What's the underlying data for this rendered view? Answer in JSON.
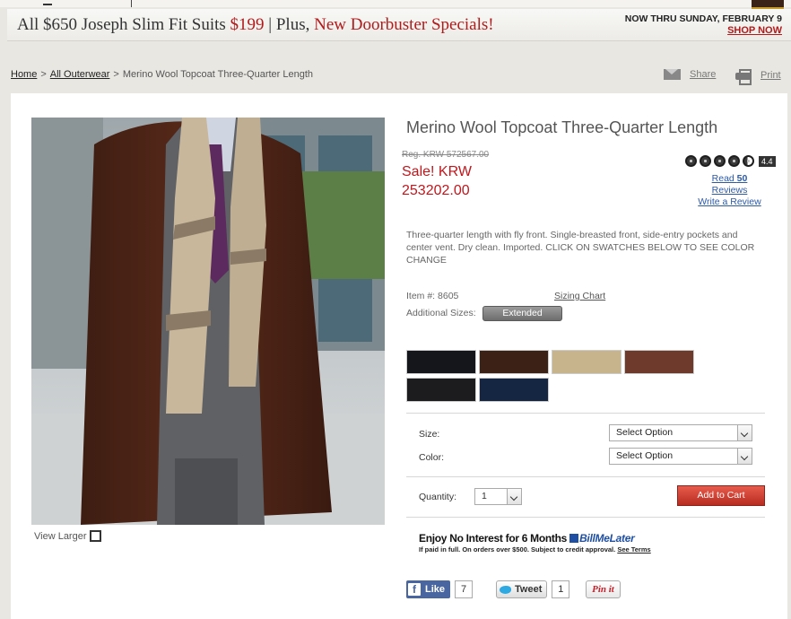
{
  "promo": {
    "text_before": "All $650 Joseph Slim Fit Suits ",
    "price": "$199",
    "text_mid": " | Plus, ",
    "highlight": "New Doorbuster Specials!",
    "dates": "NOW THRU SUNDAY, FEBRUARY 9",
    "shop_now": "SHOP NOW",
    "accent_color": "#b01b1b"
  },
  "breadcrumb": {
    "home": "Home",
    "category": "All Outerwear",
    "current": "Merino Wool Topcoat Three-Quarter Length",
    "separator": ">"
  },
  "tools": {
    "share_label": "Share",
    "print_label": "Print"
  },
  "product": {
    "title": "Merino Wool Topcoat Three-Quarter Length",
    "reg_price": "Reg. KRW 572567.00",
    "sale_label": "Sale! KRW",
    "sale_price": "253202.00",
    "rating": "4.4",
    "reviews_read_prefix": "Read ",
    "reviews_count": "50",
    "reviews_word": "Reviews",
    "write_review": "Write a Review",
    "description": "Three-quarter length with fly front. Single-breasted front, side-entry pockets and center vent. Dry clean. Imported. CLICK ON SWATCHES BELOW TO SEE COLOR CHANGE",
    "item_number": "Item #: 8605",
    "sizing_chart": "Sizing Chart",
    "additional_sizes_label": "Additional Sizes:",
    "extended_label": "Extended",
    "view_larger": "View Larger"
  },
  "swatches": [
    {
      "name": "black",
      "color": "#15161c"
    },
    {
      "name": "brown",
      "color": "#3b2116"
    },
    {
      "name": "camel",
      "color": "#c7b48d"
    },
    {
      "name": "rust-brown",
      "color": "#6d3a2b"
    },
    {
      "name": "charcoal",
      "color": "#1c1b1e"
    },
    {
      "name": "navy",
      "color": "#142641"
    }
  ],
  "options": {
    "size_label": "Size:",
    "size_value": "Select Option",
    "color_label": "Color:",
    "color_value": "Select Option",
    "quantity_label": "Quantity:",
    "quantity_value": "1",
    "add_to_cart": "Add to Cart"
  },
  "billmelater": {
    "headline": "Enjoy No Interest for 6 Months",
    "brand": "BillMeLater",
    "sub": "If paid in full. On orders over $500. Subject to credit approval.",
    "terms": "See Terms"
  },
  "social": {
    "like_label": "Like",
    "like_count": "7",
    "tweet_label": "Tweet",
    "tweet_count": "1",
    "pin_label": "Pin it"
  }
}
